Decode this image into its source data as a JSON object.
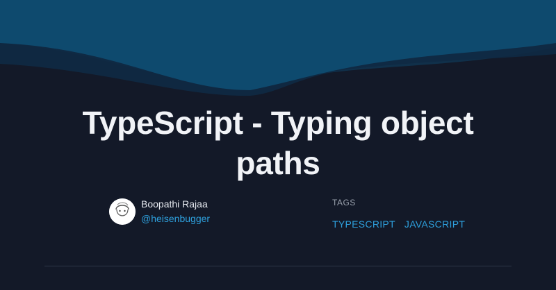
{
  "post": {
    "title": "TypeScript - Typing object paths"
  },
  "author": {
    "name": "Boopathi Rajaa",
    "handle": "@heisenbugger",
    "avatar_icon": "cartoon-face-avatar"
  },
  "tags": {
    "label": "TAGS",
    "items": [
      "TYPESCRIPT",
      "JAVASCRIPT"
    ]
  },
  "colors": {
    "background": "#131928",
    "wave_top": "#0e4a6e",
    "wave_mid": "#10304a",
    "link": "#2ea0dd",
    "title": "#f1f3f7"
  }
}
